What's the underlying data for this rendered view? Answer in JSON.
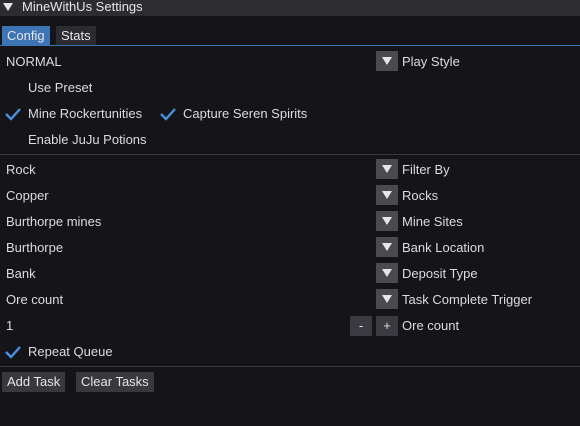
{
  "window": {
    "title": "MineWithUs Settings"
  },
  "tabs": [
    {
      "label": "Config"
    },
    {
      "label": "Stats"
    }
  ],
  "play_style": {
    "value": "NORMAL",
    "label": "Play Style"
  },
  "options": {
    "use_preset": {
      "label": "Use Preset",
      "checked": false
    },
    "mine_rockertunities": {
      "label": "Mine Rockertunities",
      "checked": true
    },
    "capture_seren_spirits": {
      "label": "Capture Seren Spirits",
      "checked": true
    },
    "enable_juju_potions": {
      "label": "Enable JuJu Potions",
      "checked": false
    }
  },
  "filter_by": {
    "value": "Rock",
    "label": "Filter By"
  },
  "rocks": {
    "value": "Copper",
    "label": "Rocks"
  },
  "mine_sites": {
    "value": "Burthorpe mines",
    "label": "Mine Sites"
  },
  "bank_location": {
    "value": "Burthorpe",
    "label": "Bank Location"
  },
  "deposit_type": {
    "value": "Bank",
    "label": "Deposit Type"
  },
  "task_complete_trigger": {
    "value": "Ore count",
    "label": "Task Complete Trigger"
  },
  "ore_count": {
    "value": "1",
    "label": "Ore count",
    "decrement": "-",
    "increment": "+"
  },
  "repeat_queue": {
    "label": "Repeat Queue",
    "checked": true
  },
  "buttons": {
    "add_task": "Add Task",
    "clear_tasks": "Clear Tasks"
  },
  "colors": {
    "accent": "#3d74b6",
    "background": "#151519",
    "title_bar": "#2d2d31",
    "check": "#4a90e2"
  }
}
